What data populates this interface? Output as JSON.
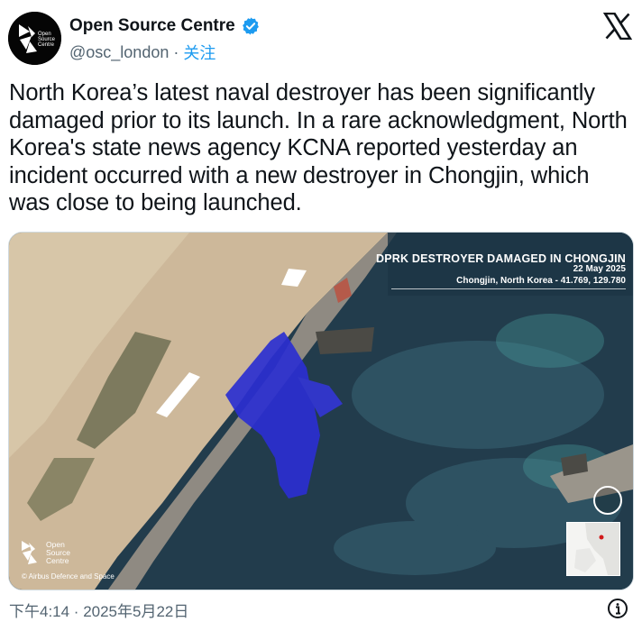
{
  "author": {
    "display_name": "Open Source Centre",
    "handle": "@osc_london",
    "separator": "·",
    "follow_label": "关注",
    "avatar_text": "Open\nSource\nCentre",
    "verified_icon": "verified-badge-icon"
  },
  "platform_logo": "x-logo-icon",
  "tweet": {
    "text": "North Korea’s latest naval destroyer has been significantly damaged prior to its launch. In a rare acknowledgment, North Korea's state news agency KCNA reported yesterday an incident occurred with a new destroyer in Chongjin, which was close to being launched."
  },
  "media": {
    "overlay_title": "DPRK DESTROYER DAMAGED IN CHONGJIN",
    "overlay_date": "22 May 2025",
    "overlay_location": "Chongjin, North Korea - 41.769, 129.780",
    "watermark_text": "Open\nSource\nCentre",
    "credit": "© Airbus Defence and Space"
  },
  "footer": {
    "timestamp": "下午4:14 · 2025年5月22日",
    "info_icon": "info-icon"
  },
  "colors": {
    "link": "#1d9bf0",
    "secondary_text": "#536471",
    "verified": "#1d9bf0",
    "tarp_blue": "#2b2fd0",
    "water": "#1f3a4a"
  }
}
